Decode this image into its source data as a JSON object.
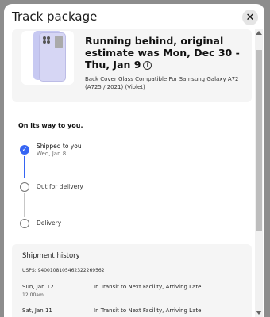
{
  "modal": {
    "title": "Track package",
    "close_glyph": "✕"
  },
  "package": {
    "status_title": "Running behind, original estimate was Mon, Dec 30 - Thu, Jan 9",
    "info_glyph": "i",
    "product_name": "Back Cover Glass Compatible For Samsung Galaxy A72 (A725 / 2021) (Violet)"
  },
  "tracking": {
    "heading": "On its way to you.",
    "steps": [
      {
        "label": "Shipped to you",
        "sub": "Wed, Jan 8",
        "done": true
      },
      {
        "label": "Out for delivery",
        "sub": "",
        "done": false
      },
      {
        "label": "Delivery",
        "sub": "",
        "done": false
      }
    ],
    "check_glyph": "✓"
  },
  "history": {
    "title": "Shipment history",
    "carrier_prefix": "USPS:",
    "tracking_number": "9400108105462322269562",
    "events": [
      {
        "date": "Sun, Jan 12",
        "time": "12:00am",
        "event": "In Transit to Next Facility, Arriving Late"
      },
      {
        "date": "Sat, Jan 11",
        "time": "",
        "event": "In Transit to Next Facility, Arriving Late"
      }
    ]
  },
  "colors": {
    "accent": "#3665f3",
    "card_bg": "#f5f5f5"
  }
}
